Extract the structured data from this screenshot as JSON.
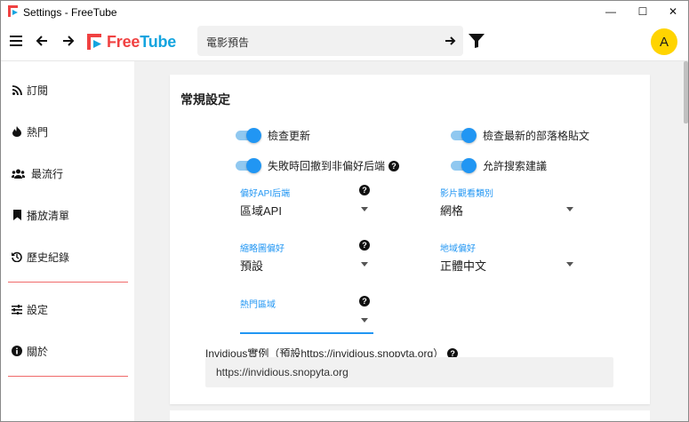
{
  "window": {
    "title": "Settings - FreeTube",
    "minimize_glyph": "—",
    "maximize_glyph": "☐",
    "close_glyph": "✕"
  },
  "topnav": {
    "logo_free": "Free",
    "logo_tube": "Tube",
    "search_value": "電影預告",
    "avatar_letter": "A"
  },
  "sidebar": {
    "items": [
      {
        "label": "訂閱",
        "icon": "rss-icon"
      },
      {
        "label": "熱門",
        "icon": "fire-icon"
      },
      {
        "label": "最流行",
        "icon": "users-icon"
      },
      {
        "label": "播放清單",
        "icon": "bookmark-icon"
      },
      {
        "label": "歷史紀錄",
        "icon": "history-icon"
      },
      {
        "label": "設定",
        "icon": "sliders-icon"
      },
      {
        "label": "關於",
        "icon": "info-icon"
      }
    ]
  },
  "settings": {
    "section_title": "常規設定",
    "toggles": [
      {
        "label": "檢查更新",
        "on": true
      },
      {
        "label": "檢查最新的部落格貼文",
        "on": true
      },
      {
        "label": "失敗時回撤到非偏好后端",
        "on": true
      },
      {
        "label": "允許搜索建議",
        "on": true
      }
    ],
    "selects": {
      "backend": {
        "label": "偏好API后端",
        "value": "區域API"
      },
      "view_type": {
        "label": "影片觀看類別",
        "value": "網格"
      },
      "thumbnail": {
        "label": "縮略圖偏好",
        "value": "預設"
      },
      "region": {
        "label": "地域偏好",
        "value": "正體中文"
      },
      "trending": {
        "label": "熱門區域",
        "value": ""
      }
    },
    "invidious_label": "Invidious實例（預設https://invidious.snopyta.org）",
    "invidious_value": "https://invidious.snopyta.org"
  },
  "colors": {
    "accent": "#2196f3",
    "logo_red": "#f04242",
    "logo_blue": "#14a4df",
    "avatar": "#ffd400",
    "divider": "#f06a6a"
  }
}
